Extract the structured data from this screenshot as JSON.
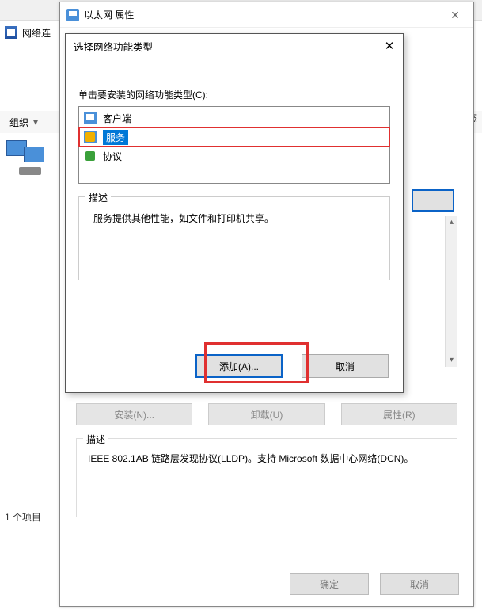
{
  "main": {
    "netconn_label": "网络连",
    "organize": "组织",
    "status_hint": "态",
    "item_count": "1 个项目"
  },
  "eth": {
    "title": "以太网 属性",
    "install_btn": "安装(N)...",
    "uninstall_btn": "卸载(U)",
    "props_btn": "属性(R)",
    "desc_label": "描述",
    "desc_text": "IEEE 802.1AB 链路层发现协议(LLDP)。支持 Microsoft 数据中心网络(DCN)。",
    "ok": "确定",
    "cancel": "取消"
  },
  "top": {
    "title": "选择网络功能类型",
    "prompt": "单击要安装的网络功能类型(C):",
    "items": {
      "client": "客户端",
      "service": "服务",
      "protocol": "协议"
    },
    "desc_label": "描述",
    "desc_text": "服务提供其他性能，如文件和打印机共享。",
    "add": "添加(A)...",
    "cancel": "取消"
  }
}
